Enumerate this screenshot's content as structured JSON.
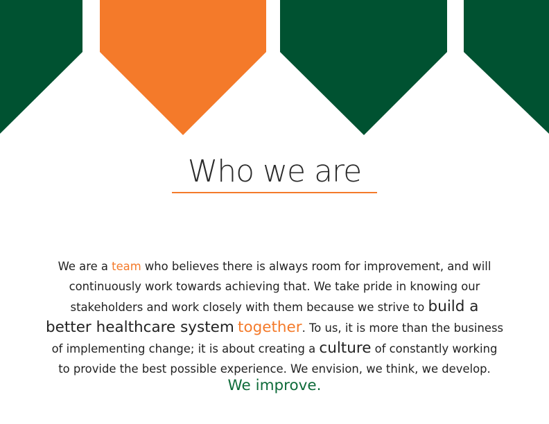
{
  "colors": {
    "green": "#005231",
    "orange": "#f47a2a",
    "text": "#222222",
    "closing_green": "#0f6b3a"
  },
  "banners": [
    {
      "name": "banner-green-1",
      "color": "green"
    },
    {
      "name": "banner-orange",
      "color": "orange"
    },
    {
      "name": "banner-green-2",
      "color": "green"
    },
    {
      "name": "banner-green-3",
      "color": "green"
    }
  ],
  "heading": {
    "title": "Who we are"
  },
  "body": {
    "line1_a": "We are a ",
    "team": "team",
    "line1_b": " who believes there is always room for improvement, and will",
    "line2": "continuously work towards achieving that. We take pride in knowing our",
    "line3_a": "stakeholders and work closely with them because we strive to ",
    "build_a": "build a",
    "line4_a": "better healthcare system",
    "together": "together",
    "line4_b": ". To us, it is more than the business",
    "line5_a": "of implementing change; it is about creating a ",
    "culture": "culture",
    "line5_b": " of constantly working",
    "line6": "to provide the best possible experience.  We envision, we think, we develop."
  },
  "closing": {
    "text": "We improve."
  }
}
